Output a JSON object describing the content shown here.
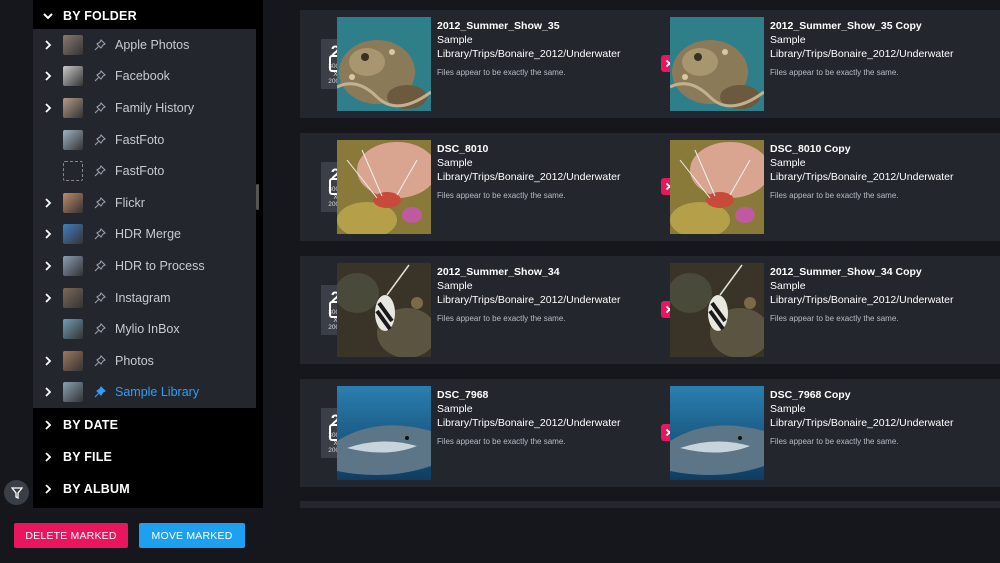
{
  "sidebar": {
    "by_folder_label": "BY FOLDER",
    "folders": [
      {
        "label": "Apple Photos",
        "thumb_color": "#8a7a70",
        "expandable": true,
        "empty": false
      },
      {
        "label": "Facebook",
        "thumb_color": "#c9c9c9",
        "expandable": true,
        "empty": false
      },
      {
        "label": "Family History",
        "thumb_color": "#b49a86",
        "expandable": true,
        "empty": false
      },
      {
        "label": "FastFoto",
        "thumb_color": "#9fb2c4",
        "expandable": false,
        "empty": false
      },
      {
        "label": "FastFoto",
        "thumb_color": "",
        "expandable": false,
        "empty": true
      },
      {
        "label": "Flickr",
        "thumb_color": "#c08a6a",
        "expandable": true,
        "empty": false
      },
      {
        "label": "HDR Merge",
        "thumb_color": "#3f7fc0",
        "expandable": true,
        "empty": false
      },
      {
        "label": "HDR to Process",
        "thumb_color": "#8a9db5",
        "expandable": true,
        "empty": false
      },
      {
        "label": "Instagram",
        "thumb_color": "#7b6a58",
        "expandable": true,
        "empty": false
      },
      {
        "label": "Mylio InBox",
        "thumb_color": "#6f9db8",
        "expandable": false,
        "empty": false
      },
      {
        "label": "Photos",
        "thumb_color": "#a0765c",
        "expandable": true,
        "empty": false
      },
      {
        "label": "Sample Library",
        "thumb_color": "#8aa0b4",
        "expandable": true,
        "empty": false,
        "selected": true
      }
    ],
    "sections": [
      {
        "label": "BY DATE"
      },
      {
        "label": "BY FILE"
      },
      {
        "label": "BY ALBUM"
      }
    ]
  },
  "duplicates": [
    {
      "count": "2",
      "dim_w": "3008",
      "dim_x": "X",
      "dim_h": "2000",
      "left": {
        "title": "2012_Summer_Show_35",
        "library": "Sample",
        "path": "Library/Trips/Bonaire_2012/Underwater",
        "note": "Files appear to be exactly the same."
      },
      "right": {
        "title": "2012_Summer_Show_35 Copy",
        "library": "Sample",
        "path": "Library/Trips/Bonaire_2012/Underwater",
        "note": "Files appear to be exactly the same."
      },
      "photo": "octopus"
    },
    {
      "count": "2",
      "dim_w": "3008",
      "dim_x": "X",
      "dim_h": "2000",
      "left": {
        "title": "DSC_8010",
        "library": "Sample",
        "path": "Library/Trips/Bonaire_2012/Underwater",
        "note": "Files appear to be exactly the same."
      },
      "right": {
        "title": "DSC_8010 Copy",
        "library": "Sample",
        "path": "Library/Trips/Bonaire_2012/Underwater",
        "note": "Files appear to be exactly the same."
      },
      "photo": "shrimp"
    },
    {
      "count": "2",
      "dim_w": "3008",
      "dim_x": "X",
      "dim_h": "2000",
      "left": {
        "title": "2012_Summer_Show_34",
        "library": "Sample",
        "path": "Library/Trips/Bonaire_2012/Underwater",
        "note": "Files appear to be exactly the same."
      },
      "right": {
        "title": "2012_Summer_Show_34 Copy",
        "library": "Sample",
        "path": "Library/Trips/Bonaire_2012/Underwater",
        "note": "Files appear to be exactly the same."
      },
      "photo": "fish"
    },
    {
      "count": "2",
      "dim_w": "3008",
      "dim_x": "X",
      "dim_h": "2000",
      "left": {
        "title": "DSC_7968",
        "library": "Sample",
        "path": "Library/Trips/Bonaire_2012/Underwater",
        "note": "Files appear to be exactly the same."
      },
      "right": {
        "title": "DSC_7968 Copy",
        "library": "Sample",
        "path": "Library/Trips/Bonaire_2012/Underwater",
        "note": "Files appear to be exactly the same."
      },
      "photo": "shark"
    }
  ],
  "footer": {
    "delete_label": "DELETE MARKED",
    "move_label": "MOVE MARKED"
  },
  "colors": {
    "accent_blue": "#1ea0f0",
    "accent_pink": "#e8175d",
    "selected_text": "#2f9ef7"
  }
}
